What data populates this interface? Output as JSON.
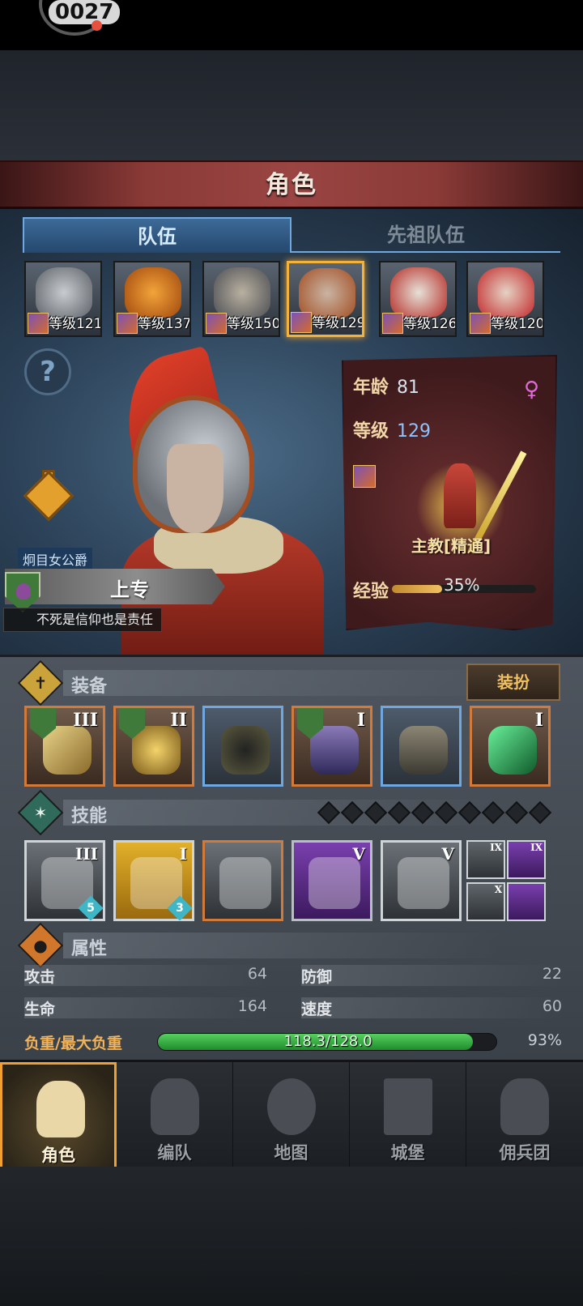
{
  "status": {
    "logo_text": "0027"
  },
  "header": {
    "title": "角色"
  },
  "tabs": [
    {
      "label": "队伍",
      "active": true
    },
    {
      "label": "先祖队伍",
      "active": false
    }
  ],
  "roster": [
    {
      "level_text": "等级121",
      "selected": false
    },
    {
      "level_text": "等级137",
      "selected": false
    },
    {
      "level_text": "等级150",
      "selected": false
    },
    {
      "level_text": "等级129",
      "selected": true
    },
    {
      "level_text": "等级126",
      "selected": false
    },
    {
      "level_text": "等级120",
      "selected": false
    }
  ],
  "hero": {
    "help_glyph": "?",
    "title_tag": "炯目女公爵",
    "trait_name": "上专",
    "trait_desc": "不死是信仰也是责任"
  },
  "info": {
    "age_label": "年龄",
    "age_value": "81",
    "level_label": "等级",
    "level_value": "129",
    "gender_glyph": "♀",
    "class_name": "主教[精通]",
    "exp_label": "经验",
    "exp_percent_text": "35%",
    "exp_fraction": 0.35
  },
  "equipment": {
    "label": "装备",
    "outfit_button": "装扮",
    "slots": [
      {
        "tier": "III",
        "border": "orange",
        "badge": true
      },
      {
        "tier": "II",
        "border": "orange",
        "badge": true
      },
      {
        "tier": "",
        "border": "blue",
        "badge": false
      },
      {
        "tier": "I",
        "border": "orange",
        "badge": true
      },
      {
        "tier": "",
        "border": "blue",
        "badge": false
      },
      {
        "tier": "I",
        "border": "orange",
        "badge": false
      }
    ]
  },
  "skills": {
    "label": "技能",
    "slots": [
      {
        "tier": "III",
        "count": "5"
      },
      {
        "tier": "I",
        "count": "3"
      },
      {
        "tier": "",
        "count": ""
      },
      {
        "tier": "V",
        "count": ""
      },
      {
        "tier": "V",
        "count": ""
      }
    ],
    "mini": [
      {
        "tier": "IX"
      },
      {
        "tier": "IX"
      },
      {
        "tier": "X"
      },
      {
        "tier": ""
      }
    ]
  },
  "attributes": {
    "label": "属性",
    "attack_label": "攻击",
    "attack_value": "64",
    "defense_label": "防御",
    "defense_value": "22",
    "hp_label": "生命",
    "hp_value": "164",
    "speed_label": "速度",
    "speed_value": "60",
    "load_label": "负重/最大负重",
    "load_text": "118.3/128.0",
    "load_percent_text": "93%",
    "load_fraction": 0.93
  },
  "nav": [
    {
      "label": "角色",
      "active": true
    },
    {
      "label": "编队",
      "active": false
    },
    {
      "label": "地图",
      "active": false
    },
    {
      "label": "城堡",
      "active": false
    },
    {
      "label": "佣兵团",
      "active": false
    }
  ],
  "colors": {
    "accent_gold": "#f0a030",
    "tab_blue": "#6fa8e0",
    "load_green": "#3cb34a"
  }
}
